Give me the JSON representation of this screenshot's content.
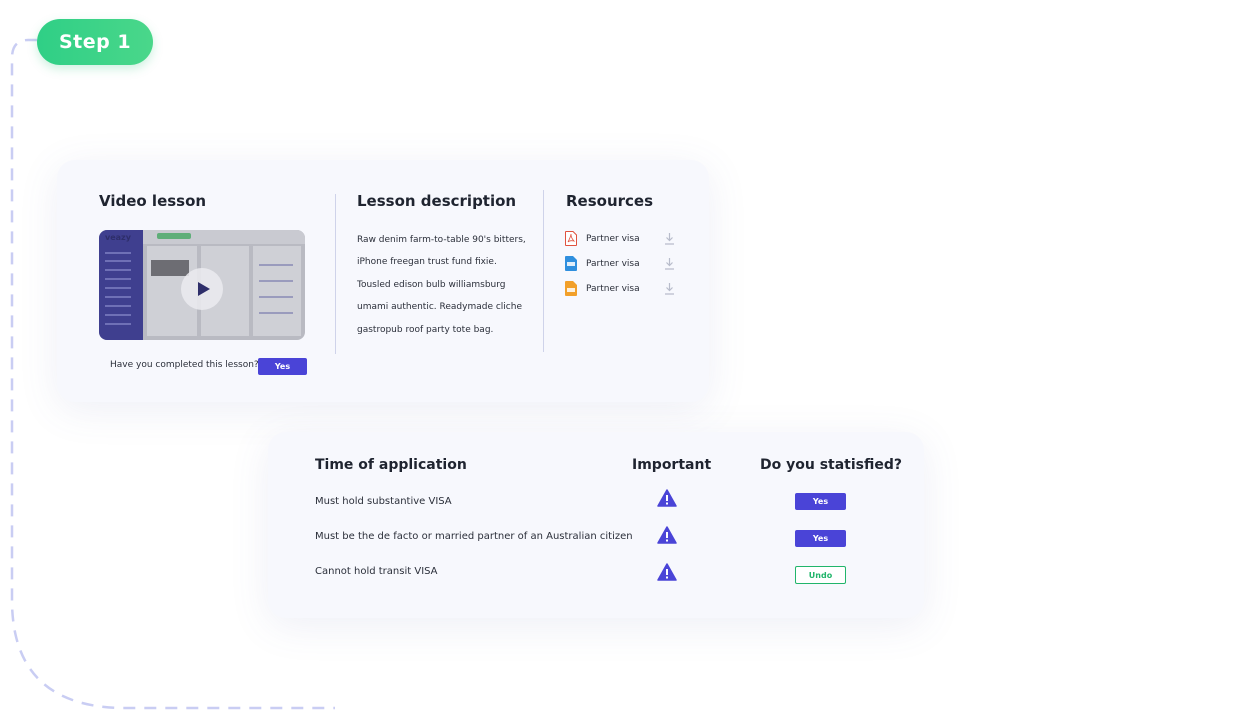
{
  "step": {
    "label": "Step 1"
  },
  "lesson_card": {
    "video": {
      "title": "Video lesson",
      "thumbnail_logo": "veazy",
      "completion_question": "Have you completed this lesson?",
      "yes_label": "Yes"
    },
    "description": {
      "title": "Lesson description",
      "lines": [
        "Raw denim farm-to-table 90's bitters,",
        "iPhone freegan trust fund fixie.",
        "Tousled edison bulb williamsburg",
        "umami authentic. Readymade cliche",
        "gastropub roof party tote bag."
      ]
    },
    "resources": {
      "title": "Resources",
      "items": [
        {
          "name": "Partner visa",
          "icon": "pdf-file-icon",
          "color": "#e0523f"
        },
        {
          "name": "Partner visa",
          "icon": "doc-file-icon",
          "color": "#2f8fde"
        },
        {
          "name": "Partner visa",
          "icon": "zip-file-icon",
          "color": "#f2a02a"
        }
      ]
    }
  },
  "requirements_card": {
    "headers": {
      "time": "Time of application",
      "important": "Important",
      "satisfied": "Do you statisfied?"
    },
    "rows": [
      {
        "text": "Must hold substantive VISA",
        "action": "Yes",
        "style": "primary"
      },
      {
        "text": "Must be the de facto or married partner of an Australian citizen",
        "action": "Yes",
        "style": "primary"
      },
      {
        "text": "Cannot hold transit VISA",
        "action": "Undo",
        "style": "outline"
      }
    ]
  },
  "colors": {
    "accent": "#4a44d7",
    "step_green": "#2fcf86",
    "undo_green": "#21b56b",
    "dashed_path": "#c9cdf3"
  }
}
